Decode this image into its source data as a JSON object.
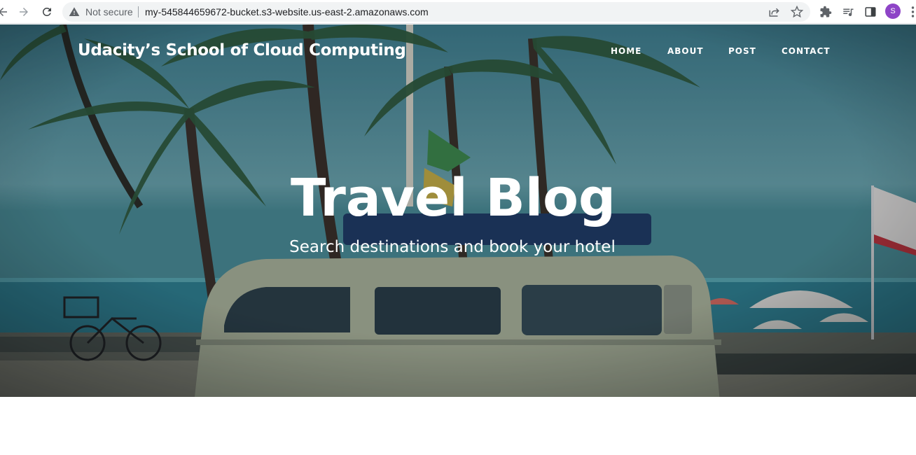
{
  "browser": {
    "security_status": "Not secure",
    "url": "my-545844659672-bucket.s3-website.us-east-2.amazonaws.com",
    "profile_initial": "S",
    "profile_color": "#8e44c7"
  },
  "site": {
    "brand": "Udacity’s School of Cloud Computing",
    "nav": {
      "home": "HOME",
      "about": "ABOUT",
      "post": "POST",
      "contact": "CONTACT"
    },
    "hero": {
      "title": "Travel Blog",
      "subtitle": "Search destinations and book your hotel"
    }
  },
  "icons": {
    "back": "arrow-left-icon",
    "forward": "arrow-right-icon",
    "reload": "reload-icon",
    "warning": "warning-triangle-icon",
    "share": "share-icon",
    "bookmark": "star-icon",
    "extensions": "puzzle-icon",
    "media": "media-queue-icon",
    "side_panel": "side-panel-icon",
    "menu": "kebab-menu-icon"
  }
}
